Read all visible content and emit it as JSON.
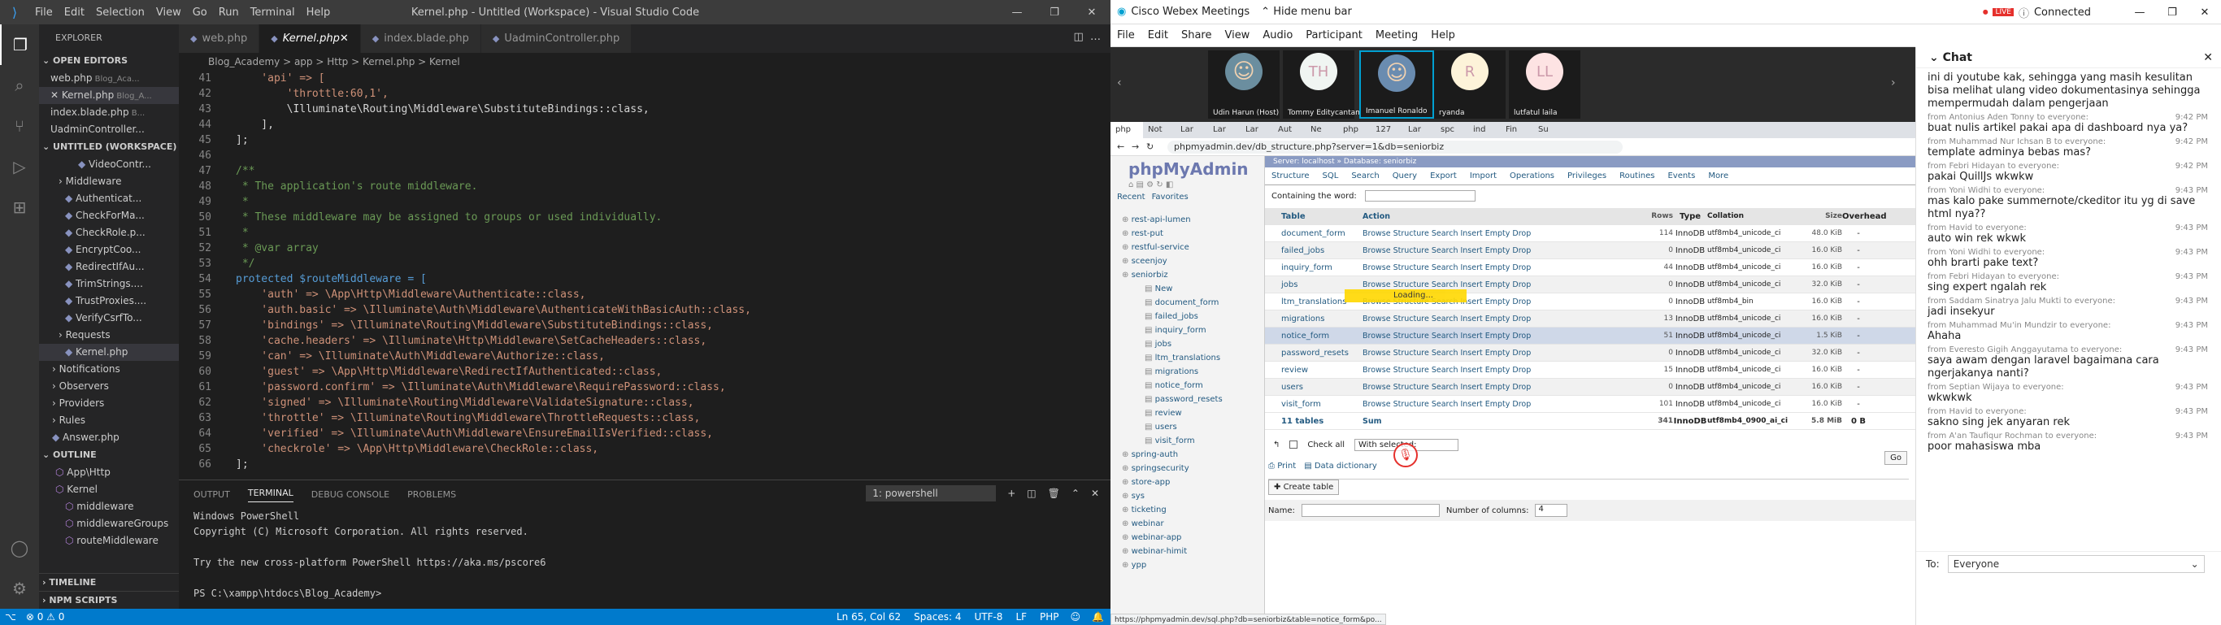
{
  "vscode": {
    "title": "Kernel.php - Untitled (Workspace) - Visual Studio Code",
    "menu": [
      "File",
      "Edit",
      "Selection",
      "View",
      "Go",
      "Run",
      "Terminal",
      "Help"
    ],
    "explorer_label": "EXPLORER",
    "open_editors_label": "OPEN EDITORS",
    "open_editors": [
      {
        "name": "web.php",
        "hint": "Blog_Aca..."
      },
      {
        "name": "Kernel.php",
        "hint": "Blog_A..."
      },
      {
        "name": "index.blade.php",
        "hint": "B..."
      },
      {
        "name": "UadminController...",
        "hint": ""
      }
    ],
    "workspace_label": "UNTITLED (WORKSPACE)",
    "tree": [
      {
        "label": "VideoContr...",
        "indent": 6
      },
      {
        "label": "Middleware",
        "indent": 3
      },
      {
        "label": "Authenticat...",
        "indent": 4
      },
      {
        "label": "CheckForMa...",
        "indent": 4
      },
      {
        "label": "CheckRole.p...",
        "indent": 4
      },
      {
        "label": "EncryptCoo...",
        "indent": 4
      },
      {
        "label": "RedirectIfAu...",
        "indent": 4
      },
      {
        "label": "TrimStrings....",
        "indent": 4
      },
      {
        "label": "TrustProxies....",
        "indent": 4
      },
      {
        "label": "VerifyCsrfTo...",
        "indent": 4
      },
      {
        "label": "Requests",
        "indent": 3
      },
      {
        "label": "Kernel.php",
        "indent": 4
      },
      {
        "label": "Notifications",
        "indent": 2
      },
      {
        "label": "Observers",
        "indent": 2
      },
      {
        "label": "Providers",
        "indent": 2
      },
      {
        "label": "Rules",
        "indent": 2
      },
      {
        "label": "Answer.php",
        "indent": 2
      }
    ],
    "outline_label": "OUTLINE",
    "outline": [
      {
        "label": "App\\Http",
        "indent": 1
      },
      {
        "label": "Kernel",
        "indent": 1
      },
      {
        "label": "middleware",
        "indent": 2
      },
      {
        "label": "middlewareGroups",
        "indent": 2
      },
      {
        "label": "routeMiddleware",
        "indent": 2
      }
    ],
    "timeline_label": "TIMELINE",
    "npm_label": "NPM SCRIPTS",
    "tabs": [
      {
        "label": "web.php",
        "active": false
      },
      {
        "label": "Kernel.php",
        "active": true
      },
      {
        "label": "index.blade.php",
        "active": false
      },
      {
        "label": "UadminController.php",
        "active": false
      }
    ],
    "breadcrumb": "Blog_Academy  >  app  >  Http  >  Kernel.php  >  Kernel",
    "code_lines": [
      {
        "n": "41",
        "t": "    'api' => [",
        "c": "cstr"
      },
      {
        "n": "42",
        "t": "        'throttle:60,1',",
        "c": "cstr"
      },
      {
        "n": "43",
        "t": "        \\Illuminate\\Routing\\Middleware\\SubstituteBindings::class,",
        "c": "cpl"
      },
      {
        "n": "44",
        "t": "    ],",
        "c": "cpl"
      },
      {
        "n": "45",
        "t": "];",
        "c": "cpl"
      },
      {
        "n": "46",
        "t": "",
        "c": "cpl"
      },
      {
        "n": "47",
        "t": "/**",
        "c": "ccom"
      },
      {
        "n": "48",
        "t": " * The application's route middleware.",
        "c": "ccom"
      },
      {
        "n": "49",
        "t": " *",
        "c": "ccom"
      },
      {
        "n": "50",
        "t": " * These middleware may be assigned to groups or used individually.",
        "c": "ccom"
      },
      {
        "n": "51",
        "t": " *",
        "c": "ccom"
      },
      {
        "n": "52",
        "t": " * @var array",
        "c": "ccom"
      },
      {
        "n": "53",
        "t": " */",
        "c": "ccom"
      },
      {
        "n": "54",
        "t": "protected $routeMiddleware = [",
        "c": "ckw"
      },
      {
        "n": "55",
        "t": "    'auth' => \\App\\Http\\Middleware\\Authenticate::class,",
        "c": "cstr"
      },
      {
        "n": "56",
        "t": "    'auth.basic' => \\Illuminate\\Auth\\Middleware\\AuthenticateWithBasicAuth::class,",
        "c": "cstr"
      },
      {
        "n": "57",
        "t": "    'bindings' => \\Illuminate\\Routing\\Middleware\\SubstituteBindings::class,",
        "c": "cstr"
      },
      {
        "n": "58",
        "t": "    'cache.headers' => \\Illuminate\\Http\\Middleware\\SetCacheHeaders::class,",
        "c": "cstr"
      },
      {
        "n": "59",
        "t": "    'can' => \\Illuminate\\Auth\\Middleware\\Authorize::class,",
        "c": "cstr"
      },
      {
        "n": "60",
        "t": "    'guest' => \\App\\Http\\Middleware\\RedirectIfAuthenticated::class,",
        "c": "cstr"
      },
      {
        "n": "61",
        "t": "    'password.confirm' => \\Illuminate\\Auth\\Middleware\\RequirePassword::class,",
        "c": "cstr"
      },
      {
        "n": "62",
        "t": "    'signed' => \\Illuminate\\Routing\\Middleware\\ValidateSignature::class,",
        "c": "cstr"
      },
      {
        "n": "63",
        "t": "    'throttle' => \\Illuminate\\Routing\\Middleware\\ThrottleRequests::class,",
        "c": "cstr"
      },
      {
        "n": "64",
        "t": "    'verified' => \\Illuminate\\Auth\\Middleware\\EnsureEmailIsVerified::class,",
        "c": "cstr"
      },
      {
        "n": "65",
        "t": "    'checkrole' => \\App\\Http\\Middleware\\CheckRole::class,",
        "c": "cstr"
      },
      {
        "n": "66",
        "t": "];",
        "c": "cpl"
      }
    ],
    "panel_tabs": [
      "OUTPUT",
      "TERMINAL",
      "DEBUG CONSOLE",
      "PROBLEMS"
    ],
    "terminal_select": "1: powershell",
    "terminal_lines": [
      "Windows PowerShell",
      "Copyright (C) Microsoft Corporation. All rights reserved.",
      "",
      "Try the new cross-platform PowerShell https://aka.ms/pscore6",
      "",
      "PS C:\\xampp\\htdocs\\Blog_Academy>"
    ],
    "status_left": "⊗ 0  ⚠ 0",
    "status_right": [
      "Ln 65, Col 62",
      "Spaces: 4",
      "UTF-8",
      "LF",
      "PHP"
    ]
  },
  "webex": {
    "app": "Cisco Webex Meetings",
    "hide_menu": "Hide menu bar",
    "live": "LIVE",
    "connected": "Connected",
    "menu": [
      "File",
      "Edit",
      "Share",
      "View",
      "Audio",
      "Participant",
      "Meeting",
      "Help"
    ],
    "participants": [
      {
        "name": "Udin Harun (Host)",
        "initials": "",
        "color": "#6b8e9f",
        "photo": true
      },
      {
        "name": "Tommy Editycantama H.",
        "initials": "TH",
        "color": "#f0f5f2",
        "photo": false
      },
      {
        "name": "Imanuel Ronaldo",
        "initials": "",
        "color": "#6a8cb0",
        "photo": true
      },
      {
        "name": "ryanda",
        "initials": "R",
        "color": "#fdf3d9",
        "photo": false
      },
      {
        "name": "lutfatul laila",
        "initials": "LL",
        "color": "#fde3e3",
        "photo": false
      }
    ],
    "chat_title": "Chat",
    "chat": [
      {
        "from": "",
        "time": "",
        "msg": "ini di youtube kak, sehingga yang masih kesulitan bisa melihat ulang video dokumentasinya sehingga mempermudah dalam pengerjaan"
      },
      {
        "from": "from Antonius Aden Tonny to everyone:",
        "time": "9:42 PM",
        "msg": "buat nulis artikel pakai apa di dashboard nya ya?"
      },
      {
        "from": "from Muhammad Nur Ichsan B to everyone:",
        "time": "9:42 PM",
        "msg": "template adminya bebas mas?"
      },
      {
        "from": "from Febri Hidayan to everyone:",
        "time": "9:42 PM",
        "msg": "pakai QuillJs wkwkw"
      },
      {
        "from": "from Yoni Widhi to everyone:",
        "time": "9:43 PM",
        "msg": "mas kalo pake summernote/ckeditor itu yg di save html nya??"
      },
      {
        "from": "from Havid to everyone:",
        "time": "9:43 PM",
        "msg": "auto win rek wkwk"
      },
      {
        "from": "from Yoni Widhi to everyone:",
        "time": "9:43 PM",
        "msg": "ohh brarti pake text?"
      },
      {
        "from": "from Febri Hidayan to everyone:",
        "time": "9:43 PM",
        "msg": "sing expert ngalah rek"
      },
      {
        "from": "from Saddam Sinatrya Jalu Mukti to everyone:",
        "time": "9:43 PM",
        "msg": "jadi insekyur"
      },
      {
        "from": "from Muhammad Mu'in Mundzir to everyone:",
        "time": "9:43 PM",
        "msg": "Ahaha"
      },
      {
        "from": "from Everesto Gigih Anggayutama to everyone:",
        "time": "9:43 PM",
        "msg": "saya awam dengan laravel bagaimana cara ngerjakanya nanti?"
      },
      {
        "from": "from Septian Wijaya to everyone:",
        "time": "9:43 PM",
        "msg": "wkwkwk"
      },
      {
        "from": "from Havid to everyone:",
        "time": "9:43 PM",
        "msg": "sakno sing jek anyaran rek"
      },
      {
        "from": "from A'an Taufiqur Rochman to everyone:",
        "time": "9:43 PM",
        "msg": "poor mahasiswa mba"
      }
    ],
    "to_label": "To:",
    "to_value": "Everyone"
  },
  "shared": {
    "url": "phpmyadmin.dev/db_structure.php?server=1&db=seniorbiz",
    "status_url": "https://phpmyadmin.dev/sql.php?db=seniorbiz&table=notice_form&po...",
    "pma_logo": "phpMyAdmin",
    "recent": "Recent",
    "favorites": "Favorites",
    "dbtree": [
      "rest-api-lumen",
      "rest-put",
      "restful-service",
      "sceenjoy",
      "seniorbiz",
      "New",
      "document_form",
      "failed_jobs",
      "inquiry_form",
      "jobs",
      "ltm_translations",
      "migrations",
      "notice_form",
      "password_resets",
      "review",
      "users",
      "visit_form",
      "spring-auth",
      "springsecurity",
      "store-app",
      "sys",
      "ticketing",
      "webinar",
      "webinar-app",
      "webinar-himit",
      "ypp"
    ],
    "server_crumb": "Server: localhost » Database: seniorbiz",
    "tabs": [
      "Structure",
      "SQL",
      "Search",
      "Query",
      "Export",
      "Import",
      "Operations",
      "Privileges",
      "Routines",
      "Events",
      "More"
    ],
    "containing": "Containing the word:",
    "headers": [
      "Table",
      "Action",
      "Rows",
      "Type",
      "Collation",
      "Size",
      "Overhead"
    ],
    "actions": "Browse  Structure  Search  Insert  Empty  Drop",
    "tables": [
      {
        "name": "document_form",
        "rows": "114",
        "type": "InnoDB",
        "col": "utf8mb4_unicode_ci",
        "size": "48.0 KiB",
        "ov": "-"
      },
      {
        "name": "failed_jobs",
        "rows": "0",
        "type": "InnoDB",
        "col": "utf8mb4_unicode_ci",
        "size": "16.0 KiB",
        "ov": "-"
      },
      {
        "name": "inquiry_form",
        "rows": "44",
        "type": "InnoDB",
        "col": "utf8mb4_unicode_ci",
        "size": "16.0 KiB",
        "ov": "-"
      },
      {
        "name": "jobs",
        "rows": "0",
        "type": "InnoDB",
        "col": "utf8mb4_unicode_ci",
        "size": "32.0 KiB",
        "ov": "-"
      },
      {
        "name": "ltm_translations",
        "rows": "0",
        "type": "InnoDB",
        "col": "utf8mb4_bin",
        "size": "16.0 KiB",
        "ov": "-"
      },
      {
        "name": "migrations",
        "rows": "13",
        "type": "InnoDB",
        "col": "utf8mb4_unicode_ci",
        "size": "16.0 KiB",
        "ov": "-"
      },
      {
        "name": "notice_form",
        "rows": "51",
        "type": "InnoDB",
        "col": "utf8mb4_unicode_ci",
        "size": "1.5 KiB",
        "ov": "-"
      },
      {
        "name": "password_resets",
        "rows": "0",
        "type": "InnoDB",
        "col": "utf8mb4_unicode_ci",
        "size": "32.0 KiB",
        "ov": "-"
      },
      {
        "name": "review",
        "rows": "15",
        "type": "InnoDB",
        "col": "utf8mb4_unicode_ci",
        "size": "16.0 KiB",
        "ov": "-"
      },
      {
        "name": "users",
        "rows": "0",
        "type": "InnoDB",
        "col": "utf8mb4_unicode_ci",
        "size": "16.0 KiB",
        "ov": "-"
      },
      {
        "name": "visit_form",
        "rows": "101",
        "type": "InnoDB",
        "col": "utf8mb4_unicode_ci",
        "size": "16.0 KiB",
        "ov": "-"
      }
    ],
    "sum": {
      "name": "11 tables",
      "label": "Sum",
      "rows": "341",
      "type": "InnoDB",
      "col": "utf8mb4_0900_ai_ci",
      "size": "5.8 MiB",
      "ov": "0 B"
    },
    "loading": "Loading...",
    "check_all": "Check all",
    "with_selected": "With selected:",
    "print": "Print",
    "data_dict": "Data dictionary",
    "create_table": "Create table",
    "name_label": "Name:",
    "num_cols_label": "Number of columns:",
    "num_cols": "4",
    "go": "Go"
  }
}
